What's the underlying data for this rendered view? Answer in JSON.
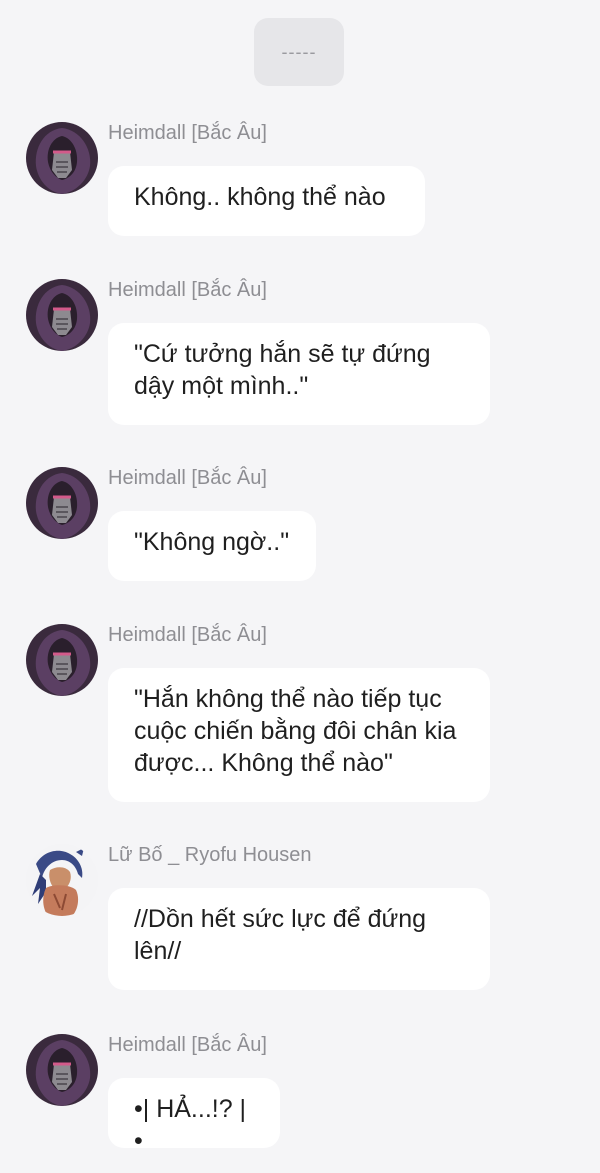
{
  "top_indicator": "-----",
  "messages": [
    {
      "sender": "Heimdall [Bắc Âu]",
      "avatar": "heimdall-avatar",
      "text": "Không.. không thể nào"
    },
    {
      "sender": "Heimdall [Bắc Âu]",
      "avatar": "heimdall-avatar",
      "text": "\"Cứ tưởng hắn sẽ tự đứng dậy một mình..\""
    },
    {
      "sender": "Heimdall [Bắc Âu]",
      "avatar": "heimdall-avatar",
      "text": "\"Không ngờ..\""
    },
    {
      "sender": "Heimdall [Bắc Âu]",
      "avatar": "heimdall-avatar",
      "text": "\"Hắn không thể nào tiếp tục cuộc chiến bằng đôi chân kia được... Không thể nào\""
    },
    {
      "sender": "Lữ Bố _ Ryofu Housen",
      "avatar": "ryofu-avatar",
      "text": "//Dồn hết sức lực để đứng lên//"
    },
    {
      "sender": "Heimdall [Bắc Âu]",
      "avatar": "heimdall-avatar",
      "text": "•| HẢ...!? |•"
    }
  ]
}
